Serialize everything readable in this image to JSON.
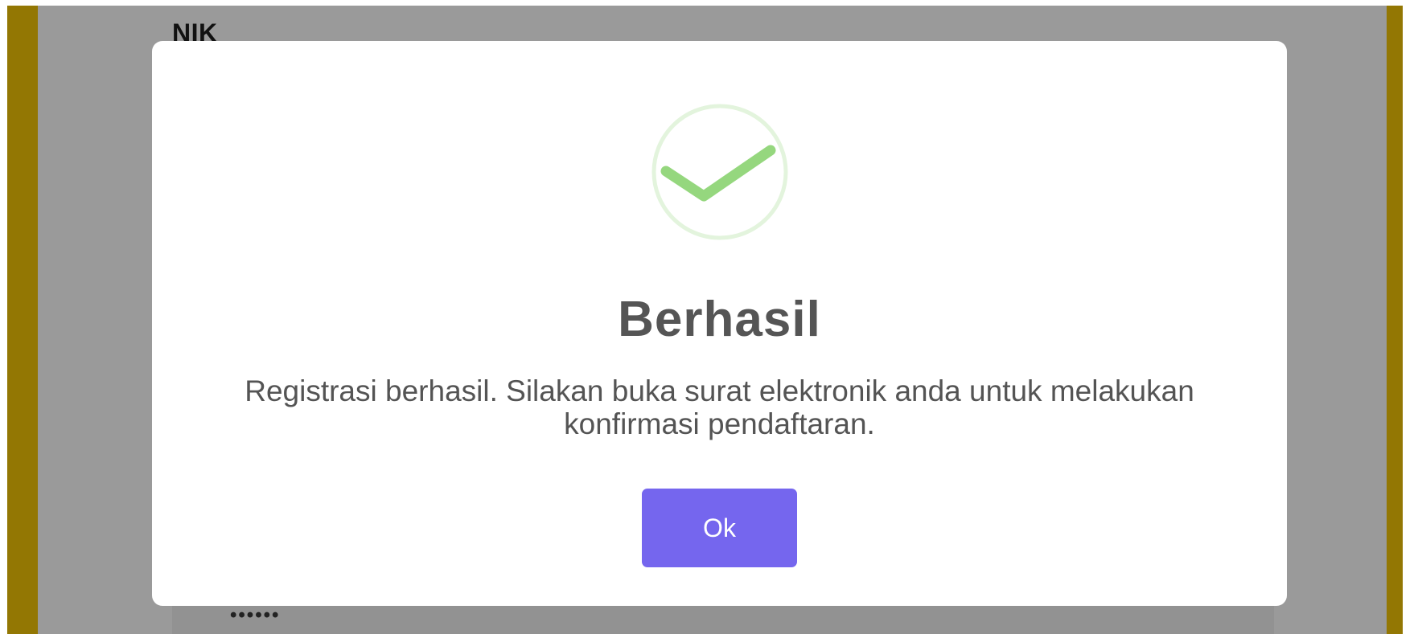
{
  "background_form": {
    "nik_label": "NIK",
    "password_value": "••••••"
  },
  "modal": {
    "icon": "success-checkmark-icon",
    "title": "Berhasil",
    "message": "Registrasi berhasil. Silakan buka surat elektronik anda untuk melakukan konfirmasi pendaftaran.",
    "ok_label": "Ok"
  },
  "colors": {
    "overlay": "#9a9a9a",
    "side_accent": "#937703",
    "check_green": "#95d77e",
    "ring_green": "#e3f4dd",
    "button": "#7566ee",
    "title_text": "#555555"
  }
}
